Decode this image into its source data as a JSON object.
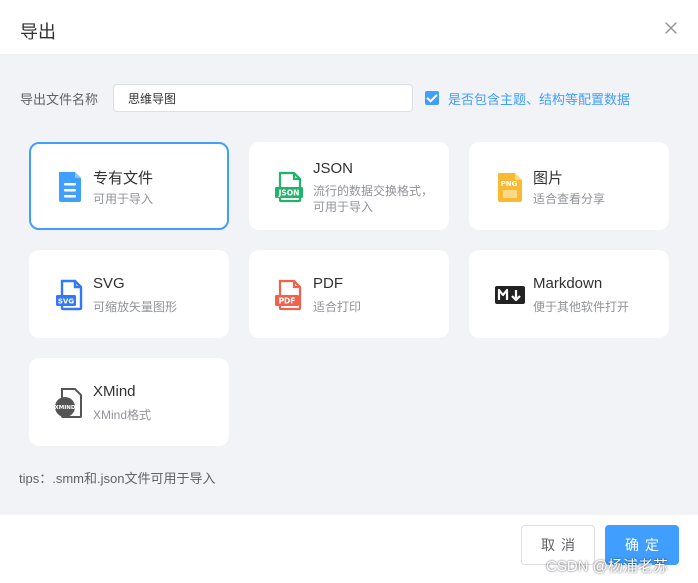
{
  "dialog": {
    "title": "导出",
    "close_icon": "close-icon"
  },
  "form": {
    "filename_label": "导出文件名称",
    "filename_value": "思维导图",
    "include_config_checked": true,
    "include_config_label": "是否包含主题、结构等配置数据"
  },
  "formats": [
    {
      "title": "专有文件",
      "desc": "可用于导入",
      "icon": "smm-file-icon",
      "selected": true
    },
    {
      "title": "JSON",
      "desc": "流行的数据交换格式，可用于导入",
      "icon": "json-file-icon",
      "selected": false
    },
    {
      "title": "图片",
      "desc": "适合查看分享",
      "icon": "png-file-icon",
      "selected": false
    },
    {
      "title": "SVG",
      "desc": "可缩放矢量图形",
      "icon": "svg-file-icon",
      "selected": false
    },
    {
      "title": "PDF",
      "desc": "适合打印",
      "icon": "pdf-file-icon",
      "selected": false
    },
    {
      "title": "Markdown",
      "desc": "便于其他软件打开",
      "icon": "markdown-icon",
      "selected": false
    },
    {
      "title": "XMind",
      "desc": "XMind格式",
      "icon": "xmind-icon",
      "selected": false
    }
  ],
  "tips": "tips：.smm和.json文件可用于导入",
  "footer": {
    "cancel_label": "取消",
    "confirm_label": "确定"
  },
  "watermark": "CSDN @杨浦老苏",
  "colors": {
    "accent": "#409eff",
    "body_bg": "#f2f3f7",
    "json_green": "#21b36b",
    "png_yellow": "#f9b933",
    "svg_blue": "#3478f6",
    "pdf_red": "#f0624c",
    "markdown_dark": "#222222",
    "xmind_gray": "#555555"
  }
}
